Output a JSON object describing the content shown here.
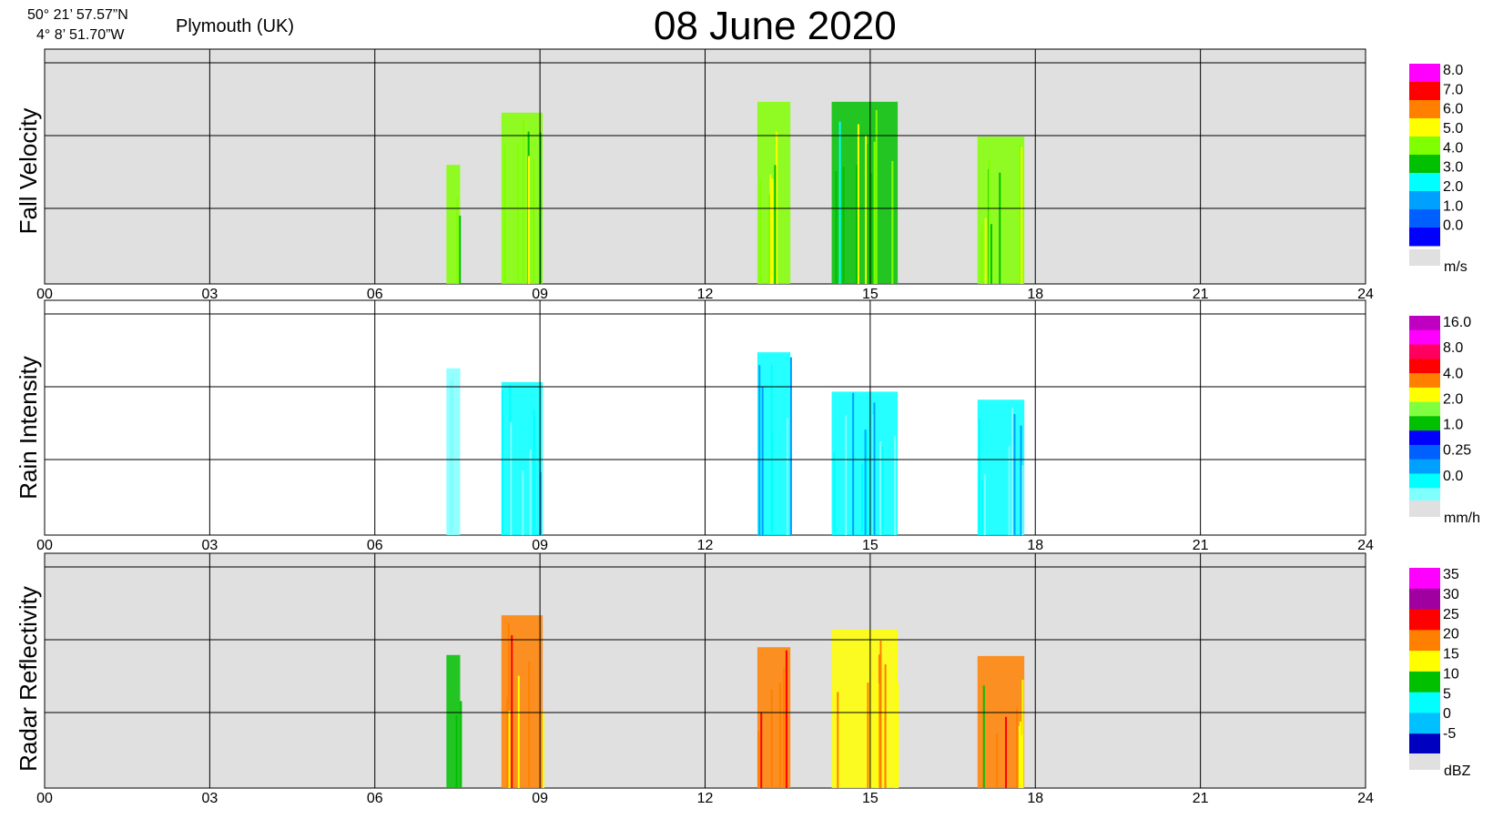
{
  "header": {
    "latitude": "50° 21’ 57.57”N",
    "longitude": "4°  8’ 51.70”W",
    "location": "Plymouth (UK)",
    "title": "08 June  2020"
  },
  "chart_data": [
    {
      "type": "heatmap",
      "title": "08 June  2020",
      "ylabel": "Fall Velocity",
      "unit": "m/s",
      "x_ticks": [
        "00",
        "03",
        "06",
        "09",
        "12",
        "15",
        "18",
        "21",
        "24"
      ],
      "xlim": [
        0,
        24
      ],
      "background": "#e0e0e0",
      "colorbar": {
        "labels": [
          "8.0",
          "7.0",
          "6.0",
          "5.0",
          "4.0",
          "3.0",
          "2.0",
          "1.0",
          "0.0"
        ],
        "colors": [
          "#ff00ff",
          "#ff0000",
          "#ff8000",
          "#ffff00",
          "#80ff00",
          "#00c000",
          "#00ffff",
          "#00a0ff",
          "#0060ff",
          "#0000ff"
        ],
        "no_data_color": "#e0e0e0"
      },
      "events": [
        {
          "start": 7.3,
          "end": 7.55,
          "value": 4.5
        },
        {
          "start": 8.3,
          "end": 9.05,
          "value": 4.2
        },
        {
          "start": 12.95,
          "end": 13.55,
          "value": 4.5
        },
        {
          "start": 14.3,
          "end": 15.5,
          "value": 4.0
        },
        {
          "start": 16.95,
          "end": 17.8,
          "value": 4.2
        }
      ]
    },
    {
      "type": "heatmap",
      "ylabel": "Rain Intensity",
      "unit": "mm/h",
      "x_ticks": [
        "00",
        "03",
        "06",
        "09",
        "12",
        "15",
        "18",
        "21",
        "24"
      ],
      "xlim": [
        0,
        24
      ],
      "background": "#ffffff",
      "colorbar": {
        "labels": [
          "16.0",
          "8.0",
          "4.0",
          "2.0",
          "1.0",
          "0.25",
          "0.0"
        ],
        "colors": [
          "#c000c0",
          "#ff00ff",
          "#ff0060",
          "#ff0000",
          "#ff8000",
          "#ffff00",
          "#80ff40",
          "#00c000",
          "#0000ff",
          "#0060ff",
          "#00a0ff",
          "#00ffff",
          "#80ffff"
        ],
        "no_data_color": "#e0e0e0"
      },
      "events": [
        {
          "start": 7.3,
          "end": 7.55,
          "value": 0.3
        },
        {
          "start": 8.3,
          "end": 9.05,
          "value": 0.8
        },
        {
          "start": 12.95,
          "end": 13.55,
          "value": 0.9
        },
        {
          "start": 14.3,
          "end": 15.5,
          "value": 0.7
        },
        {
          "start": 16.95,
          "end": 17.8,
          "value": 1.0
        }
      ]
    },
    {
      "type": "heatmap",
      "ylabel": "Radar Reflectivity",
      "unit": "dBZ",
      "x_ticks": [
        "00",
        "03",
        "06",
        "09",
        "12",
        "15",
        "18",
        "21",
        "24"
      ],
      "xlim": [
        0,
        24
      ],
      "background": "#e0e0e0",
      "colorbar": {
        "labels": [
          "35",
          "30",
          "25",
          "20",
          "15",
          "10",
          "5",
          "0",
          "-5"
        ],
        "colors": [
          "#ff00ff",
          "#a000a0",
          "#ff0000",
          "#ff8000",
          "#ffff00",
          "#00c000",
          "#00ffff",
          "#00c0ff",
          "#0000c0"
        ],
        "no_data_color": "#e0e0e0"
      },
      "events": [
        {
          "start": 7.3,
          "end": 7.55,
          "value": 10
        },
        {
          "start": 8.3,
          "end": 9.05,
          "value": 18
        },
        {
          "start": 12.95,
          "end": 13.55,
          "value": 22
        },
        {
          "start": 14.3,
          "end": 15.5,
          "value": 16
        },
        {
          "start": 16.95,
          "end": 17.8,
          "value": 18
        }
      ]
    }
  ]
}
